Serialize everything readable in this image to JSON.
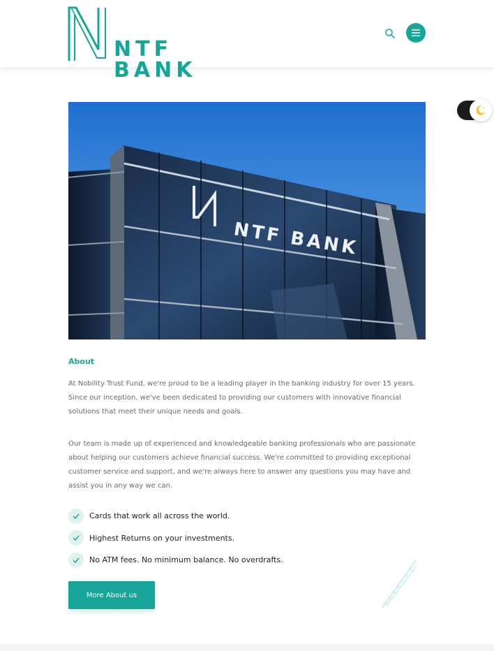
{
  "brand": {
    "name": "NTF BANK",
    "accent": "#17a59a"
  },
  "header": {
    "search_icon": "search-icon",
    "menu_icon": "hamburger-menu-icon"
  },
  "theme_toggle": {
    "icon": "moon-icon"
  },
  "hero": {
    "sign_text": "NTF BANK"
  },
  "about": {
    "label": "About",
    "paragraph_1": "At Nobility Trust Fund, we're proud to be a leading player in the banking industry for over 15 years. Since our inception, we've been dedicated to providing our customers with innovative financial solutions that meet their unique needs and goals.",
    "paragraph_2": "Our team is made up of experienced and knowledgeable banking professionals who are passionate about helping our customers achieve financial success. We're committed to providing exceptional customer service and support, and we're always here to answer any questions you may have and assist you in any way we can.",
    "features": [
      "Cards that work all across the world.",
      "Highest Returns on your investments.",
      "No ATM fees. No minimum balance. No overdrafts."
    ],
    "cta_label": "More About us"
  }
}
